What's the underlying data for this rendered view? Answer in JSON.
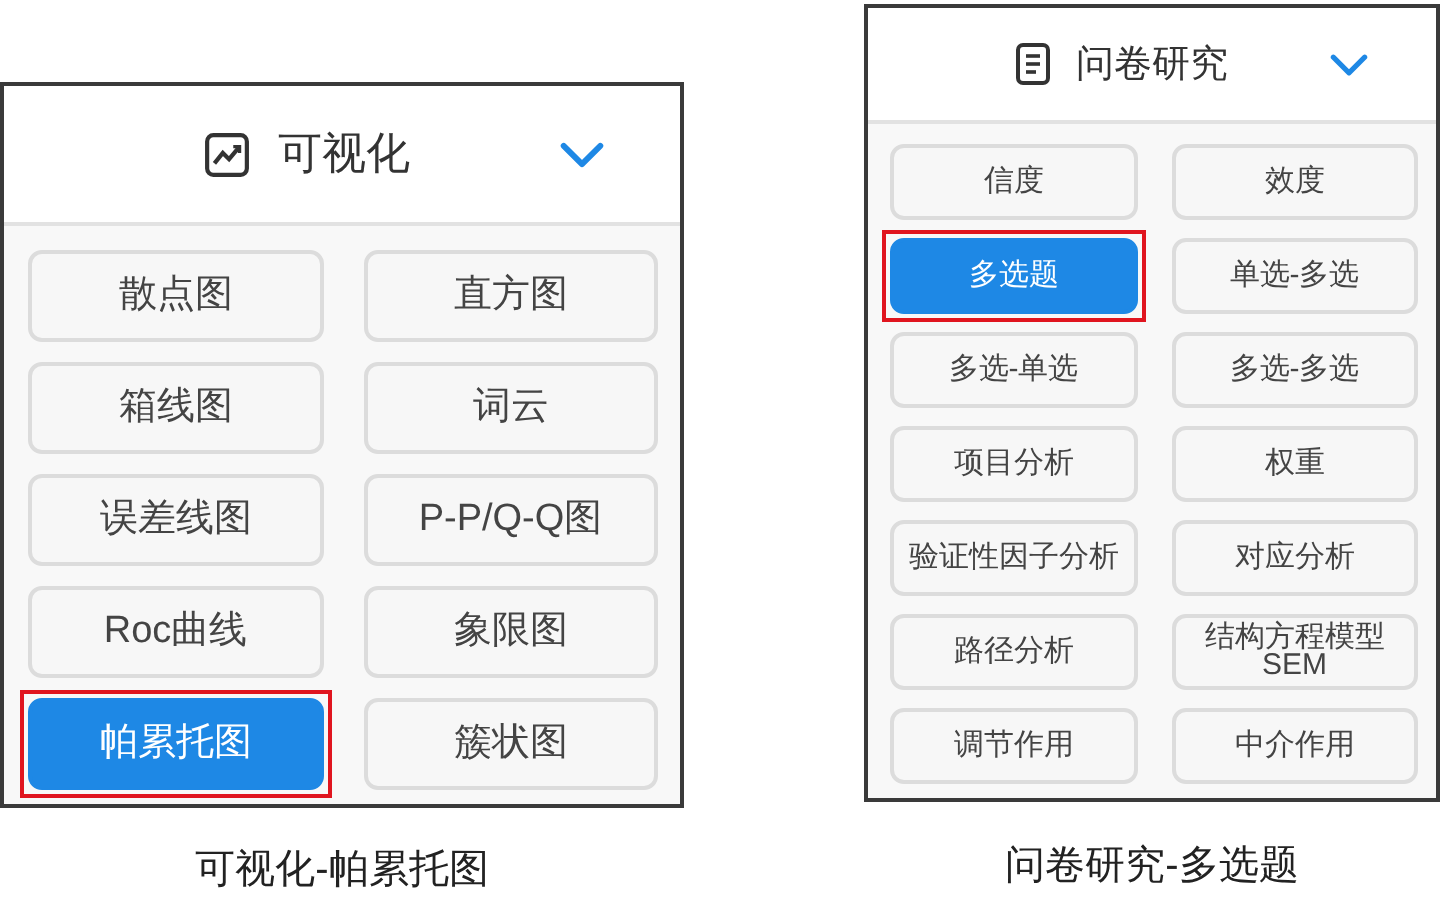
{
  "panels": [
    {
      "kind": "chart",
      "title": "可视化",
      "caption": "可视化-帕累托图",
      "buttons": [
        {
          "label": "散点图",
          "selected": false
        },
        {
          "label": "直方图",
          "selected": false
        },
        {
          "label": "箱线图",
          "selected": false
        },
        {
          "label": "词云",
          "selected": false
        },
        {
          "label": "误差线图",
          "selected": false
        },
        {
          "label": "P-P/Q-Q图",
          "selected": false
        },
        {
          "label": "Roc曲线",
          "selected": false
        },
        {
          "label": "象限图",
          "selected": false
        },
        {
          "label": "帕累托图",
          "selected": true
        },
        {
          "label": "簇状图",
          "selected": false
        }
      ]
    },
    {
      "kind": "document",
      "title": "问卷研究",
      "caption": "问卷研究-多选题",
      "buttons": [
        {
          "label": "信度",
          "selected": false
        },
        {
          "label": "效度",
          "selected": false
        },
        {
          "label": "多选题",
          "selected": true
        },
        {
          "label": "单选-多选",
          "selected": false
        },
        {
          "label": "多选-单选",
          "selected": false
        },
        {
          "label": "多选-多选",
          "selected": false
        },
        {
          "label": "项目分析",
          "selected": false
        },
        {
          "label": "权重",
          "selected": false
        },
        {
          "label": "验证性因子分析",
          "selected": false
        },
        {
          "label": "对应分析",
          "selected": false
        },
        {
          "label": "路径分析",
          "selected": false
        },
        {
          "label": "结构方程模型SEM",
          "selected": false
        },
        {
          "label": "调节作用",
          "selected": false
        },
        {
          "label": "中介作用",
          "selected": false
        }
      ]
    }
  ]
}
